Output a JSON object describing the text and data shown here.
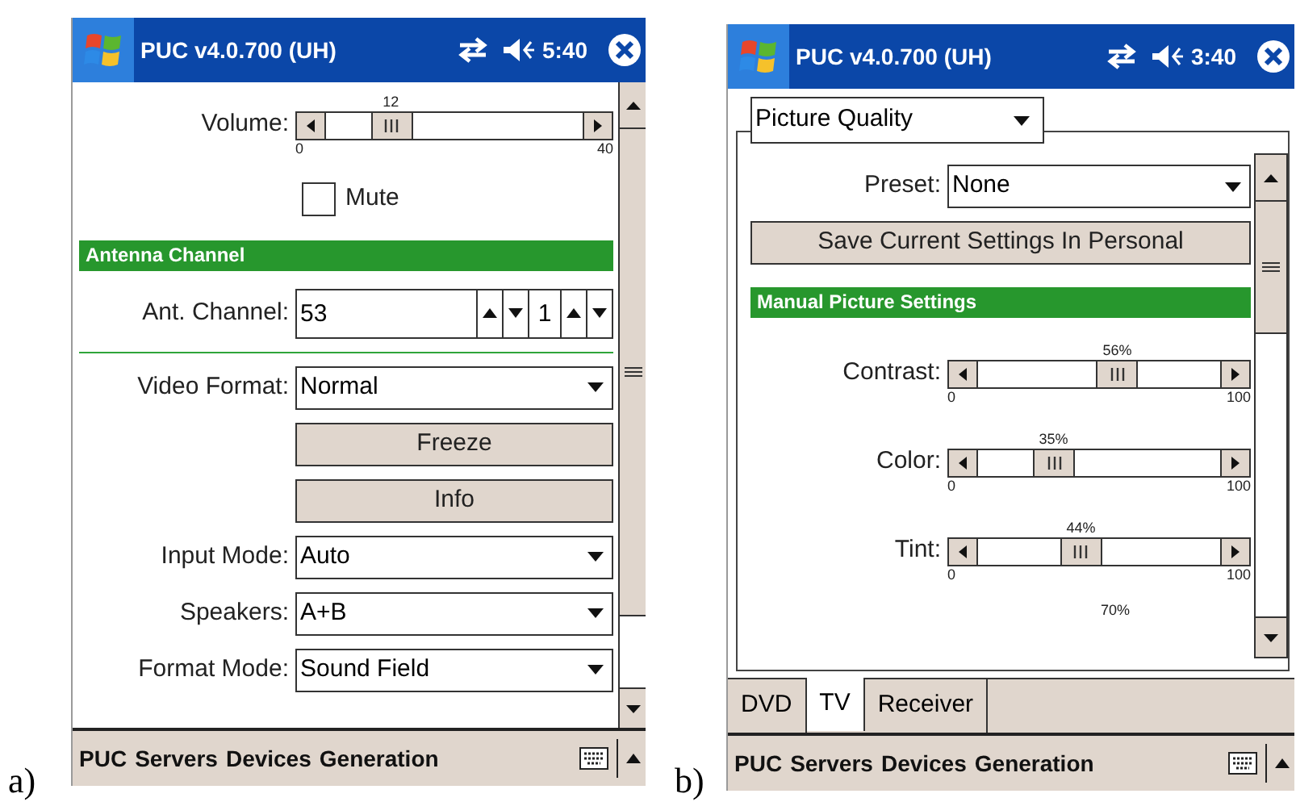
{
  "panels": [
    {
      "caption": "a)",
      "title": "PUC v4.0.700 (UH)",
      "time": "5:40",
      "controls": [
        {
          "kind": "slider",
          "label": "Volume:",
          "value_label": "12",
          "min": "0",
          "max": "40",
          "level": 0.3
        },
        {
          "kind": "checkbox",
          "label": "Mute",
          "checked": false
        },
        {
          "kind": "header",
          "text": "Antenna Channel"
        },
        {
          "kind": "spinner",
          "label": "Ant. Channel:",
          "value": "53",
          "value_2": "1"
        },
        {
          "kind": "rule"
        },
        {
          "kind": "dropdown",
          "label": "Video Format:",
          "value": "Normal"
        },
        {
          "kind": "button",
          "text": "Freeze"
        },
        {
          "kind": "button",
          "text": "Info"
        },
        {
          "kind": "dropdown",
          "label": "Input Mode:",
          "value": "Auto"
        },
        {
          "kind": "dropdown",
          "label": "Speakers:",
          "value": "A+B"
        },
        {
          "kind": "dropdown",
          "label": "Format Mode:",
          "value": "Sound Field"
        }
      ],
      "menu": [
        "PUC",
        "Servers",
        "Devices",
        "Generation"
      ]
    },
    {
      "caption": "b)",
      "title": "PUC v4.0.700 (UH)",
      "time": "3:40",
      "group": "Picture Quality",
      "controls": [
        {
          "kind": "dropdown",
          "label": "Preset:",
          "value": "None"
        },
        {
          "kind": "button",
          "text": "Save Current Settings In Personal"
        },
        {
          "kind": "header",
          "text": "Manual Picture Settings"
        },
        {
          "kind": "slider",
          "label": "Contrast:",
          "value_label": "56%",
          "min": "0",
          "max": "100",
          "level": 0.56
        },
        {
          "kind": "slider",
          "label": "Color:",
          "value_label": "35%",
          "min": "0",
          "max": "100",
          "level": 0.35
        },
        {
          "kind": "slider",
          "label": "Tint:",
          "value_label": "44%",
          "min": "0",
          "max": "100",
          "level": 0.44
        },
        {
          "kind": "readout",
          "text": "70%"
        }
      ],
      "tabs": [
        {
          "label": "DVD",
          "selected": false
        },
        {
          "label": "TV",
          "selected": true
        },
        {
          "label": "Receiver",
          "selected": false
        }
      ],
      "menu": [
        "PUC",
        "Servers",
        "Devices",
        "Generation"
      ]
    }
  ]
}
